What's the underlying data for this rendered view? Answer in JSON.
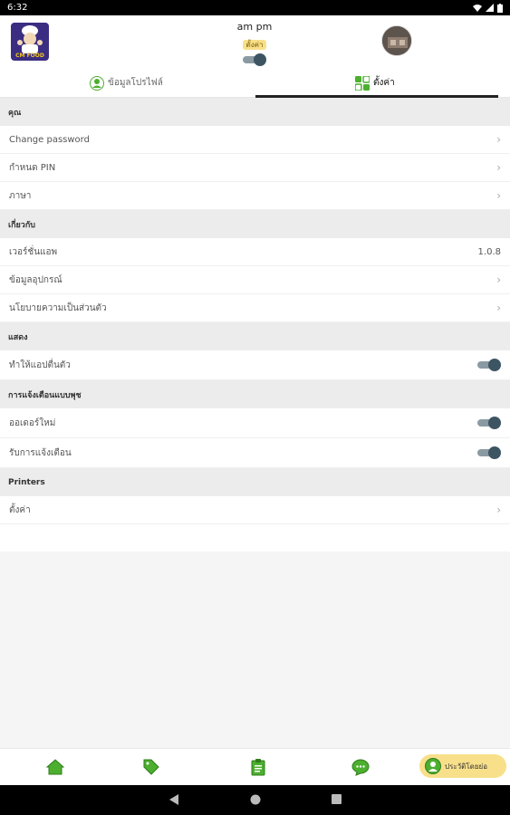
{
  "status_bar": {
    "time": "6:32",
    "icons": [
      "wifi-icon",
      "signal-icon",
      "battery-icon"
    ]
  },
  "header": {
    "logo_text": "CM FOOD",
    "shop_name": "am pm",
    "settings_badge": "ตั้งค่า",
    "toggle_on": true
  },
  "tabs": [
    {
      "label": "ข้อมูลโปรไฟล์",
      "icon": "profile-icon",
      "active": false
    },
    {
      "label": "ตั้งค่า",
      "icon": "grid-icon",
      "active": true
    }
  ],
  "sections": {
    "you": {
      "title": "คุณ",
      "items": [
        {
          "label": "Change password"
        },
        {
          "label": "กำหนด PIN"
        },
        {
          "label": "ภาษา"
        }
      ]
    },
    "about": {
      "title": "เกี่ยวกับ",
      "items": [
        {
          "label": "เวอร์ชั่นแอพ",
          "value": "1.0.8"
        },
        {
          "label": "ข้อมูลอุปกรณ์"
        },
        {
          "label": "นโยบายความเป็นส่วนตัว"
        }
      ]
    },
    "display": {
      "title": "แสดง",
      "items": [
        {
          "label": "ทำให้แอปตื่นตัว",
          "toggle_on": true
        }
      ]
    },
    "push": {
      "title": "การแจ้งเตือนแบบพุช",
      "items": [
        {
          "label": "ออเดอร์ใหม่",
          "toggle_on": true
        },
        {
          "label": "รับการแจ้งเตือน",
          "toggle_on": true
        }
      ]
    },
    "printers": {
      "title": "Printers",
      "items": [
        {
          "label": "ตั้งค่า"
        }
      ]
    }
  },
  "bottom_nav": {
    "items": [
      "home-icon",
      "tag-icon",
      "clipboard-icon",
      "chat-icon"
    ],
    "active_label": "ประวัติโดยย่อ",
    "accent_color": "#4caf2f",
    "active_bg": "#f8e08a"
  }
}
